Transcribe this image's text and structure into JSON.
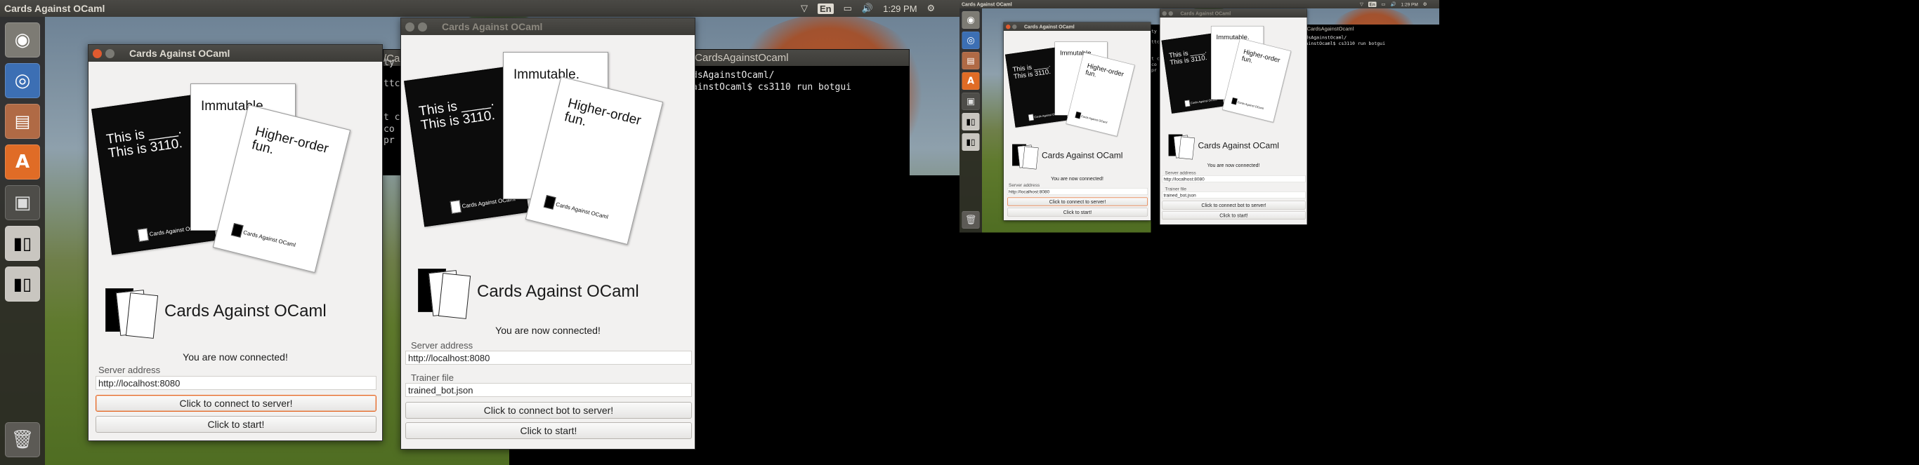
{
  "screens": [
    {
      "topbar": {
        "app_title": "Cards Against OCaml",
        "keyboard": "En",
        "time": "1:29 PM"
      },
      "terminal": {
        "title": "/CardsAgainstOcaml",
        "lines": [
          "dsAgainstOcaml/",
          "ainstOcaml$ cs3110 run botgui"
        ],
        "side_fragments": [
          "ty",
          "ttc",
          "t c",
          "co",
          "pr"
        ]
      },
      "windows": [
        {
          "title": "Cards Against OCaml",
          "black_card": [
            "This is ____.",
            "This is 3110."
          ],
          "white_card_1": "Immutable.",
          "white_card_2": [
            "Higher-order",
            "fun."
          ],
          "card_brand": "Cards Against OCaml",
          "app_name": "Cards Against OCaml",
          "status": "You are now connected!",
          "server_label": "Server address",
          "server_value": "http://localhost:8080",
          "connect_label": "Click to connect to server!",
          "start_label": "Click to start!"
        },
        {
          "title": "Cards Against OCaml",
          "black_card": [
            "This is ____.",
            "This is 3110."
          ],
          "white_card_1": "Immutable.",
          "white_card_2": [
            "Higher-order",
            "fun."
          ],
          "card_brand": "Cards Against OCaml",
          "app_name": "Cards Against OCaml",
          "status": "You are now connected!",
          "server_label": "Server address",
          "server_value": "http://localhost:8080",
          "trainer_label": "Trainer file",
          "trainer_value": "trained_bot.json",
          "connect_label": "Click to connect bot to server!",
          "start_label": "Click to start!"
        }
      ]
    },
    {
      "topbar": {
        "app_title": "Cards Against OCaml",
        "keyboard": "En",
        "time": "1:29 PM"
      },
      "terminal": {
        "title": "/CardsAgainstOcaml",
        "lines": [
          "dsAgainstOcaml/",
          "ainstOcaml$ cs3110 run botgui"
        ],
        "side_fragments": [
          "ty",
          "ttc",
          "t c",
          "co",
          "pr"
        ]
      },
      "windows": [
        {
          "title": "Cards Against OCaml",
          "black_card": [
            "This is ____.",
            "This is 3110."
          ],
          "white_card_1": "Immutable.",
          "white_card_2": [
            "Higher-order",
            "fun."
          ],
          "card_brand": "Cards Against OCaml",
          "app_name": "Cards Against OCaml",
          "status": "You are now connected!",
          "server_label": "Server address",
          "server_value": "http://localhost:8080",
          "connect_label": "Click to connect to server!",
          "start_label": "Click to start!"
        },
        {
          "title": "Cards Against OCaml",
          "black_card": [
            "This is ____.",
            "This is 3110."
          ],
          "white_card_1": "Immutable.",
          "white_card_2": [
            "Higher-order",
            "fun."
          ],
          "card_brand": "Cards Against OCaml",
          "app_name": "Cards Against OCaml",
          "status": "You are now connected!",
          "server_label": "Server address",
          "server_value": "http://localhost:8080",
          "trainer_label": "Trainer file",
          "trainer_value": "trained_bot.json",
          "connect_label": "Click to connect bot to server!",
          "start_label": "Click to start!"
        }
      ]
    }
  ],
  "launcher_icons": [
    "ubuntu-dash-icon",
    "chromium-icon",
    "files-icon",
    "software-center-icon",
    "workspace-switcher-icon",
    "cards-app-icon",
    "cards-app-icon-2",
    "trash-icon"
  ],
  "colors": {
    "focus_accent": "#e6641f",
    "close_button": "#e05a2f",
    "terminal_bg": "#2b0b1f",
    "panel_bg": "#3c3b37"
  }
}
